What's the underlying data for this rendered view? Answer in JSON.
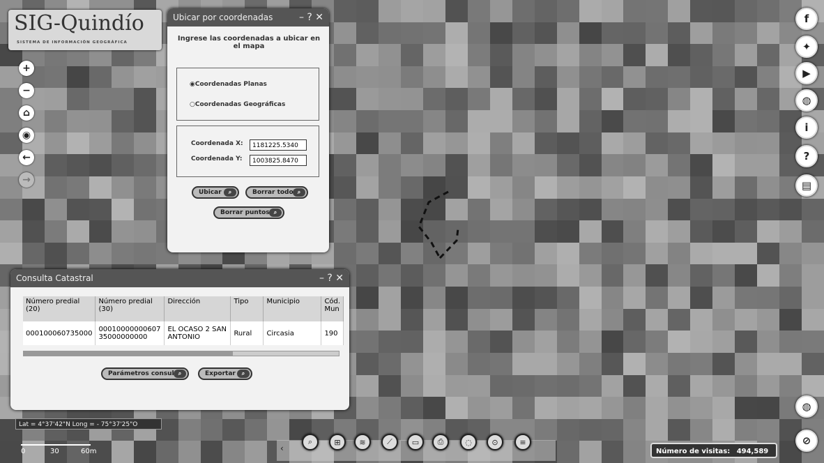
{
  "logo": {
    "name": "SIG-Quindío",
    "subtitle": "SISTEMA DE INFORMACIÓN GEOGRÁFICA"
  },
  "nav_buttons": [
    {
      "icon": "zoom-in-icon",
      "glyph": "+"
    },
    {
      "icon": "zoom-out-icon",
      "glyph": "−"
    },
    {
      "icon": "home-icon",
      "glyph": "⌂"
    },
    {
      "icon": "eye-icon",
      "glyph": "◉"
    },
    {
      "icon": "back-arrow-icon",
      "glyph": "←"
    },
    {
      "icon": "forward-arrow-icon",
      "glyph": "→"
    }
  ],
  "coords_panel": {
    "title": "Ubicar por coordenadas",
    "controls": "– ? ✕",
    "heading": "Ingrese las coordenadas a ubicar en el mapa",
    "option_planas": "Coordenadas Planas",
    "option_geograficas": "Coordenadas Geográficas",
    "label_x": "Coordenada X:",
    "value_x": "1181225.5340",
    "label_y": "Coordenada Y:",
    "value_y": "1003825.8470",
    "btn_ubicar": "Ubicar",
    "btn_borrar_todo": "Borrar todo",
    "btn_borrar_puntos": "Borrar puntos"
  },
  "catastral_panel": {
    "title": "Consulta Catastral",
    "controls": "– ? ✕",
    "columns": [
      "Número predial (20)",
      "Número predial (30)",
      "Dirección",
      "Tipo",
      "Municipio",
      "Cód. Mun"
    ],
    "rows": [
      [
        "000100060735000",
        "00010000000607 35000000000",
        "EL OCASO 2 SAN ANTONIO",
        "Rural",
        "Circasia",
        "190"
      ]
    ],
    "btn_parametros": "Parámetros consulta",
    "btn_exportar": "Exportar"
  },
  "coordinate_readout": "Lat = 4°37'42\"N Long = - 75°37'25\"O",
  "scale": {
    "labels": [
      "0",
      "30",
      "60m"
    ]
  },
  "social": [
    "facebook-icon",
    "twitter-icon",
    "youtube-icon",
    "globe-icon",
    "info-icon",
    "help-icon",
    "document-icon"
  ],
  "toolbar_icons": [
    "search-icon",
    "grid-icon",
    "layers-icon",
    "measure-icon",
    "folder-icon",
    "print-icon",
    "map-icon",
    "pin-icon",
    "list-icon"
  ],
  "visits": {
    "label": "Número de visitas:",
    "value": "494,589"
  },
  "colors": {
    "panel_title": "#555555",
    "button": "#bbbbbb"
  }
}
